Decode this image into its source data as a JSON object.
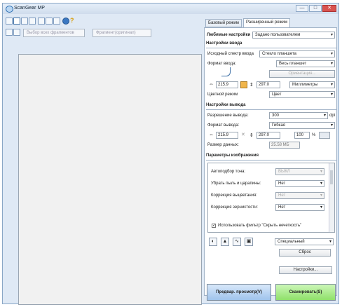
{
  "window": {
    "title": "ScanGear MP",
    "min": "—",
    "max": "□",
    "close": "✕"
  },
  "toolbar": {
    "select_frames_placeholder": "Выбор всех фрагментов",
    "crop_placeholder": "Фрагмент(оригинал)"
  },
  "tabs": {
    "basic": "Базовый режим",
    "advanced": "Расширенный режим"
  },
  "favorites": {
    "label": "Любимые настройки",
    "value": "Задано пользователем"
  },
  "input": {
    "header": "Настройки ввода",
    "select_source_label": "Исходный спектр ввода",
    "select_source_value": "Стекло планшета",
    "paper_size_label": "Формат ввода:",
    "paper_size_value": "Весь планшет",
    "orientation_button": "Ориентация...",
    "width": "215.9",
    "height": "297.0",
    "unit": "Миллиметры",
    "color_mode_label": "Цветной режим",
    "color_mode_value": "Цвет"
  },
  "output": {
    "header": "Настройки вывода",
    "resolution_label": "Разрешение вывода:",
    "resolution_value": "300",
    "resolution_unit": "dpi",
    "size_label": "Формат вывода:",
    "size_value": "Гибкая",
    "width": "215.9",
    "height": "297.0",
    "scale": "100",
    "scale_unit": "%",
    "data_size_label": "Размер данных:",
    "data_size_value": "25.58 МБ"
  },
  "image": {
    "header": "Параметры изображения",
    "rows": [
      {
        "label": "Автоподбор тона:",
        "value": "ВЫКЛ",
        "disabled": true
      },
      {
        "label": "Убрать пыль и царапины:",
        "value": "Нет",
        "disabled": false
      },
      {
        "label": "Коррекция выцветания:",
        "value": "Нет",
        "disabled": true
      },
      {
        "label": "Коррекция зернистости:",
        "value": "Нет",
        "disabled": false
      }
    ],
    "unsharp_label": "Использовать фильтр \"Скрыть нечеткость\""
  },
  "tools": {
    "channel_value": "Специальный",
    "reset_button": "Сброс",
    "settings_button": "Настройки..."
  },
  "actions": {
    "preview": "Предвар. просмотр(V)",
    "scan": "Сканировать(S)"
  },
  "colors": {
    "preview_button": "#b9d4f2",
    "scan_button": "#a9ee8a",
    "accent": "#2f6fb3"
  }
}
